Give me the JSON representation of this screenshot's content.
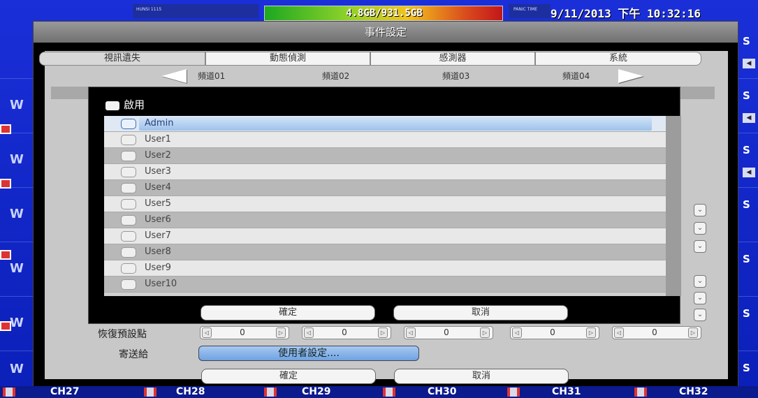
{
  "status_bar": {
    "left_small": "HUNSI 1115",
    "hdd_usage": "4.8GB/931.5GB",
    "right_small": "PANIC TIME",
    "datetime": "9/11/2013 下午 10:32:16"
  },
  "dialog": {
    "title": "事件設定",
    "tabs": [
      "視訊遺失",
      "動態偵測",
      "感測器",
      "系統"
    ],
    "channels": [
      "頻道01",
      "頻道02",
      "頻道03",
      "頻道04"
    ],
    "restore_label": "恢復預設點",
    "spinner_values": [
      "0",
      "0",
      "0",
      "0",
      "0"
    ],
    "sendto_label": "寄送給",
    "sendto_button": "使用者設定....",
    "ok_label": "確定",
    "cancel_label": "取消"
  },
  "popup": {
    "enable_label": "啟用",
    "users": [
      "Admin",
      "User1",
      "User2",
      "User3",
      "User4",
      "User5",
      "User6",
      "User7",
      "User8",
      "User9",
      "User10"
    ],
    "ok_label": "確定",
    "cancel_label": "取消"
  },
  "channel_strip": [
    "CH27",
    "CH28",
    "CH29",
    "CH30",
    "CH31",
    "CH32"
  ],
  "colors": {
    "background": "#0b1fb8",
    "selected_row": "#9ec2ea",
    "send_button": "#6fa2e0"
  }
}
